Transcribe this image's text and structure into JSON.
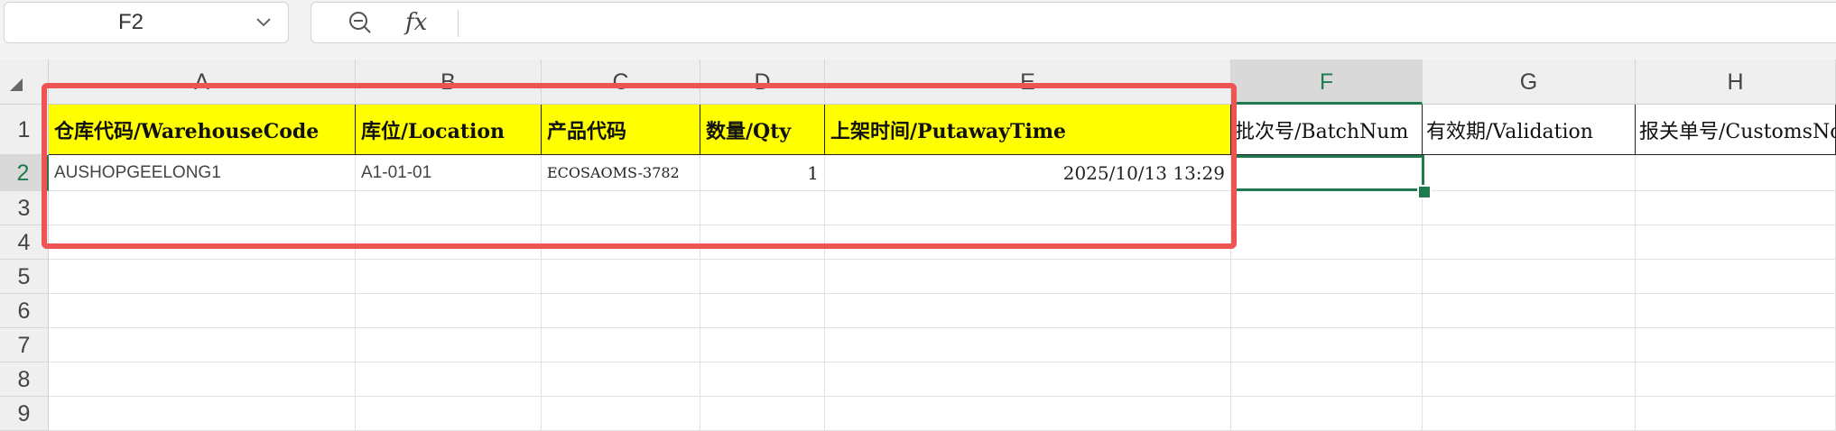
{
  "name_box": {
    "cell_ref": "F2"
  },
  "formula_bar": {
    "fx_label": "fx",
    "content": ""
  },
  "columns": [
    "A",
    "B",
    "C",
    "D",
    "E",
    "F",
    "G",
    "H"
  ],
  "rows": [
    "1",
    "2",
    "3",
    "4",
    "5",
    "6",
    "7",
    "8",
    "9"
  ],
  "selected_cell": "F2",
  "header_row": {
    "A": "仓库代码/WarehouseCode",
    "B": "库位/Location",
    "C": "产品代码",
    "D": "数量/Qty",
    "E": "上架时间/PutawayTime",
    "F": "批次号/BatchNum",
    "G": "有效期/Validation",
    "H": "报关单号/CustomsNo"
  },
  "data_row_2": {
    "A": "AUSHOPGEELONG1",
    "B": "A1-01-01",
    "C": "ECOSAOMS-3782",
    "D": "1",
    "E": "2025/10/13 13:29"
  },
  "colors": {
    "header_fill": "#ffff00",
    "selection": "#1f7a4d",
    "annotation_box": "#ef5454"
  }
}
